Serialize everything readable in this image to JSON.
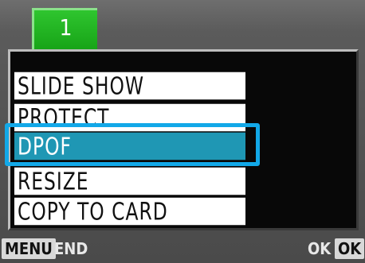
{
  "tab": {
    "number": "1"
  },
  "menu": {
    "items": [
      {
        "label": "SLIDE SHOW"
      },
      {
        "label": "PROTECT"
      },
      {
        "label": "DPOF",
        "selected": true
      },
      {
        "label": "RESIZE"
      },
      {
        "label": "COPY TO CARD"
      }
    ]
  },
  "footer": {
    "menu_key": "MENU",
    "menu_action": "END",
    "ok_action": "OK",
    "ok_key": "OK"
  },
  "colors": {
    "selected_bg": "#1f97b4",
    "highlight_border": "#12a8e8",
    "tab_green": "#17a417"
  }
}
